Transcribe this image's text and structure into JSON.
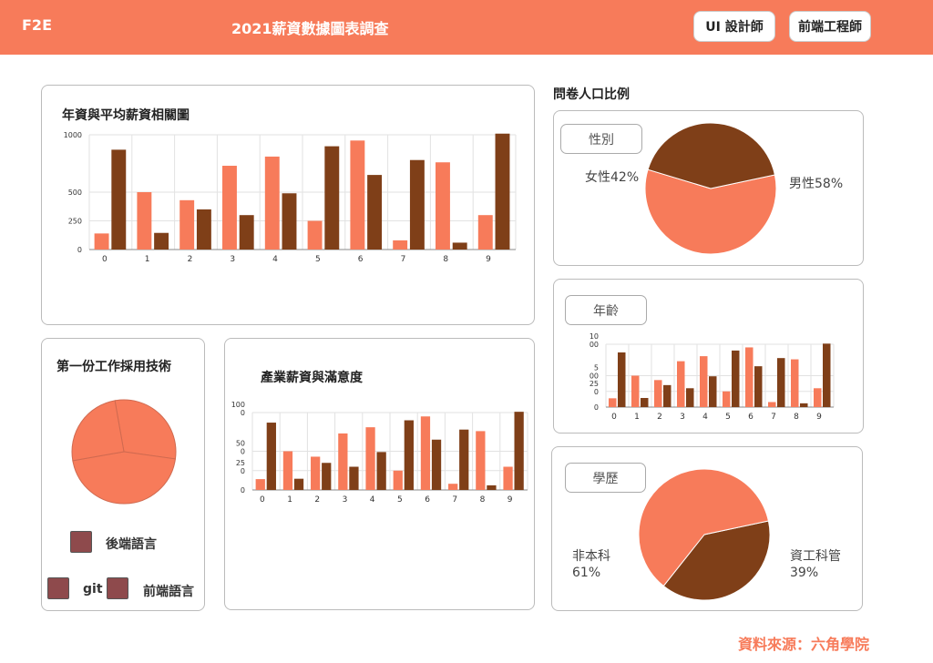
{
  "header": {
    "brand": "F2E",
    "title": "2021薪資數據圖表調查",
    "buttons": [
      "UI 設計師",
      "前端工程師"
    ]
  },
  "cards": {
    "salary_title": "年資與平均薪資相關圖",
    "tech_title": "第一份工作採用技術",
    "industry_title": "產業薪資與滿意度",
    "survey_title": "問卷人口比例",
    "gender_pill": "性別",
    "age_pill": "年齡",
    "edu_pill": "學歷"
  },
  "labels": {
    "female": "女性42%",
    "male": "男性58%",
    "non_cs": "非本科",
    "non_cs_pct": "61%",
    "cs": "資工科管",
    "cs_pct": "39%"
  },
  "legend": {
    "backend": "後端語言",
    "git": "git",
    "frontend": "前端語言"
  },
  "footer": {
    "source": "資料來源：六角學院"
  },
  "colors": {
    "primary": "#f77b5a",
    "secondary": "#7f3f18",
    "legend": "#8e4a4c"
  },
  "chart_data": [
    {
      "id": "salary",
      "type": "bar",
      "title": "年資與平均薪資相關圖",
      "categories": [
        "0",
        "1",
        "2",
        "3",
        "4",
        "5",
        "6",
        "7",
        "8",
        "9"
      ],
      "series": [
        {
          "values": [
            140,
            500,
            430,
            730,
            810,
            250,
            950,
            80,
            760,
            300
          ]
        },
        {
          "values": [
            870,
            145,
            350,
            300,
            490,
            900,
            650,
            780,
            60,
            1010
          ]
        }
      ],
      "yticks": [
        "0",
        "250",
        "500",
        "1000"
      ],
      "ylim": [
        0,
        1000
      ],
      "grid": true
    },
    {
      "id": "tech",
      "type": "pie",
      "title": "第一份工作採用技術",
      "slices": [
        {
          "name": "後端語言",
          "value": 30
        },
        {
          "name": "git",
          "value": 45
        },
        {
          "name": "前端語言",
          "value": 25
        }
      ]
    },
    {
      "id": "industry",
      "type": "bar",
      "title": "產業薪資與滿意度",
      "categories": [
        "0",
        "1",
        "2",
        "3",
        "4",
        "5",
        "6",
        "7",
        "8",
        "9"
      ],
      "series": [
        {
          "values": [
            140,
            500,
            430,
            730,
            810,
            250,
            950,
            80,
            760,
            300
          ]
        },
        {
          "values": [
            870,
            145,
            350,
            300,
            490,
            900,
            650,
            780,
            60,
            1010
          ]
        }
      ],
      "yticks": [
        "0",
        "25\n0",
        "50\n0",
        "100\n0"
      ],
      "ylim": [
        0,
        1000
      ],
      "grid": true
    },
    {
      "id": "gender",
      "type": "pie",
      "title": "性別",
      "slices": [
        {
          "name": "女性",
          "value": 42
        },
        {
          "name": "男性",
          "value": 58
        }
      ]
    },
    {
      "id": "age",
      "type": "bar",
      "title": "年齡",
      "categories": [
        "0",
        "1",
        "2",
        "3",
        "4",
        "5",
        "6",
        "7",
        "8",
        "9"
      ],
      "series": [
        {
          "values": [
            140,
            500,
            430,
            730,
            810,
            250,
            950,
            80,
            760,
            300
          ]
        },
        {
          "values": [
            870,
            145,
            350,
            300,
            490,
            900,
            650,
            780,
            60,
            1010
          ]
        }
      ],
      "yticks": [
        "0",
        "25\n0",
        "5\n00",
        "10\n00"
      ],
      "ylim": [
        0,
        1000
      ],
      "grid": true
    },
    {
      "id": "education",
      "type": "pie",
      "title": "學歷",
      "slices": [
        {
          "name": "非本科",
          "value": 61
        },
        {
          "name": "資工科管",
          "value": 39
        }
      ]
    }
  ]
}
